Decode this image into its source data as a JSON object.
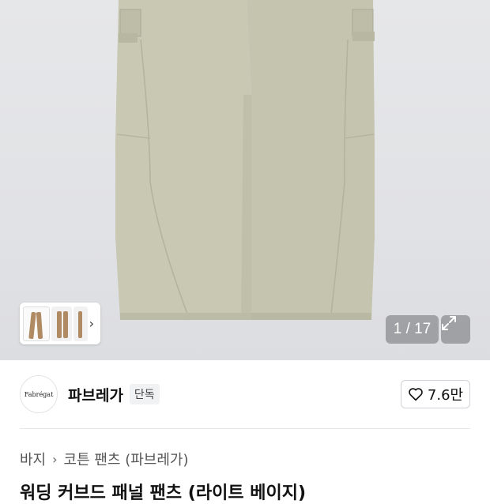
{
  "gallery": {
    "counter": "1 / 17",
    "thumbnail_count": 3
  },
  "brand": {
    "logo_text": "Fabrégat",
    "name": "파브레가",
    "badge": "단독",
    "likes": "7.6만"
  },
  "breadcrumb": {
    "items": [
      "바지",
      "코튼 팬츠 (파브레가)"
    ]
  },
  "product": {
    "title": "워딩 커브드 패널 팬츠 (라이트 베이지)"
  },
  "icons": {
    "thumbnail_next": "chevron-right-icon",
    "expand": "expand-icon",
    "like": "heart-outline-icon",
    "breadcrumb_separator": "chevron-right-icon"
  },
  "colors": {
    "pants": "#c9c9b4",
    "hero_background": "#e2e3e6",
    "overlay": "#6e7074"
  }
}
